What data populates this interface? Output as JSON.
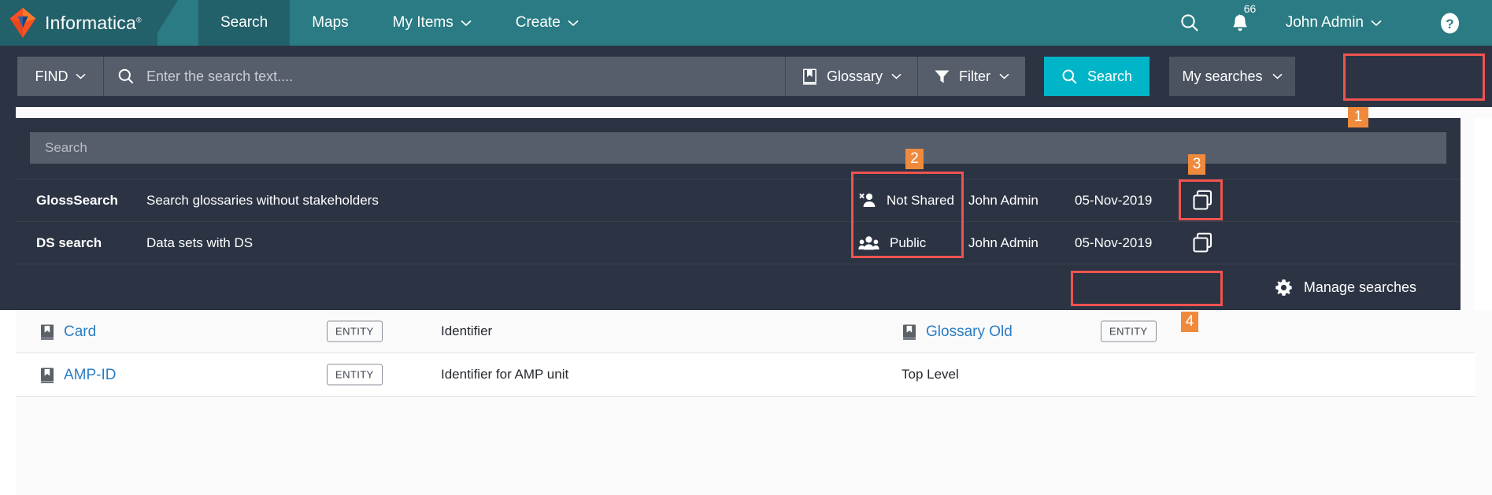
{
  "header": {
    "brand": "Informatica",
    "brand_tm": "®",
    "nav": [
      {
        "label": "Search",
        "icon": "none",
        "active": true,
        "caret": false
      },
      {
        "label": "Maps",
        "icon": "none",
        "active": false,
        "caret": false
      },
      {
        "label": "My Items",
        "icon": "chevron-down-icon",
        "active": false,
        "caret": true
      },
      {
        "label": "Create",
        "icon": "chevron-down-icon",
        "active": false,
        "caret": true
      }
    ],
    "search_icon": "search-icon",
    "bell_icon": "bell-icon",
    "notification_count": "66",
    "user_name": "John Admin",
    "help_icon": "help-icon"
  },
  "searchbar": {
    "find_label": "FIND",
    "search_placeholder": "Enter the search text....",
    "search_value": "",
    "glossary_label": "Glossary",
    "glossary_icon": "book-icon",
    "filter_label": "Filter",
    "filter_icon": "funnel-icon",
    "search_button_label": "Search",
    "search_button_icon": "search-icon",
    "my_searches_label": "My searches",
    "accent_color": "#00b5c8"
  },
  "dropdown": {
    "search_placeholder": "Search",
    "search_value": "",
    "rows": [
      {
        "name": "GlossSearch",
        "description": "Search glossaries without stakeholders",
        "sharing": "Not Shared",
        "sharing_icon": "person-not-shared-icon",
        "owner": "John Admin",
        "date": "05-Nov-2019",
        "copy_icon": "copy-icon"
      },
      {
        "name": "DS search",
        "description": "Data sets with DS",
        "sharing": "Public",
        "sharing_icon": "people-public-icon",
        "owner": "John Admin",
        "date": "05-Nov-2019",
        "copy_icon": "copy-icon"
      }
    ],
    "manage_label": "Manage searches",
    "manage_icon": "gear-icon"
  },
  "results": [
    {
      "name": "Card",
      "name_icon": "book-icon",
      "type_pill": "ENTITY",
      "description": "Identifier",
      "glossary": "Glossary Old",
      "glossary_icon": "book-icon",
      "glossary_pill": "ENTITY"
    },
    {
      "name": "AMP-ID",
      "name_icon": "book-icon",
      "type_pill": "ENTITY",
      "description": "Identifier for AMP unit",
      "glossary": "Top Level",
      "glossary_icon": "none",
      "glossary_pill": ""
    }
  ],
  "annotations": {
    "highlight_color": "#f0534f",
    "badge_color": "#ef8a3c",
    "markers": [
      {
        "number": "1",
        "target": "my-searches-button"
      },
      {
        "number": "2",
        "target": "sharing-column"
      },
      {
        "number": "3",
        "target": "copy-search-button"
      },
      {
        "number": "4",
        "target": "manage-searches-button"
      }
    ]
  }
}
